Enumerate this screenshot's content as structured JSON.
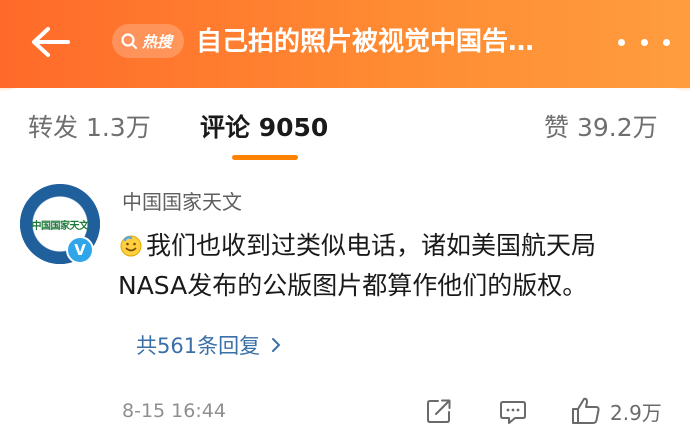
{
  "header": {
    "back_icon": "arrow-left-icon",
    "hot_search_label": "热搜",
    "title": "自己拍的照片被视觉中国告…",
    "more_icon": "more-dots-icon",
    "colors": {
      "bar_start": "#ff6a2a",
      "bar_end": "#ff9d3e"
    }
  },
  "tabs": {
    "forward": "转发 1.3万",
    "comment": "评论 9050",
    "like": "赞 39.2万",
    "active_color": "#ff8200"
  },
  "comment": {
    "author": "中国国家天文",
    "avatar_logo_text": "中国国家天文",
    "verified_icon": "verified-v-icon",
    "emoji_icon": "smile-hand-emoji-icon",
    "text_line1": "我们也收到过类似电话，诸如美国航天局",
    "text_line2": "NASA发布的公版图片都算作他们的版权。",
    "replies_label": "共561条回复",
    "time": "8-15 16:44",
    "like_count": "2.9万",
    "link_color": "#3a6fa8"
  }
}
